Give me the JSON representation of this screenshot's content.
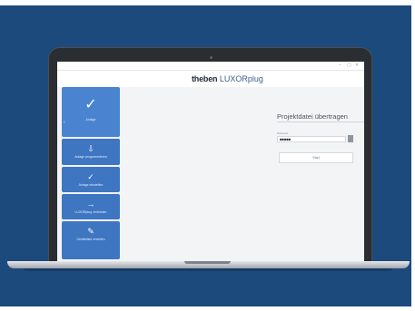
{
  "window": {
    "controls": [
      "–",
      "▢",
      "✕"
    ]
  },
  "brand": {
    "bold": "theben",
    "light": "LUXORplug"
  },
  "sidebar": {
    "steps": [
      {
        "label": "Anlage",
        "icon": "check-icon"
      },
      {
        "label": "Anlage programmieren",
        "icon": "download-icon"
      },
      {
        "label": "Anlage einstellen",
        "icon": "check-icon"
      },
      {
        "label": "LUXORplug verbinden",
        "icon": "arrow-right-icon"
      },
      {
        "label": "Geräteliste erstellen",
        "icon": "pencil-icon"
      }
    ]
  },
  "panel": {
    "title": "Projektdatei übertragen",
    "field_label": "Passwort",
    "password_value": "●●●●●",
    "button_label": "Start"
  }
}
